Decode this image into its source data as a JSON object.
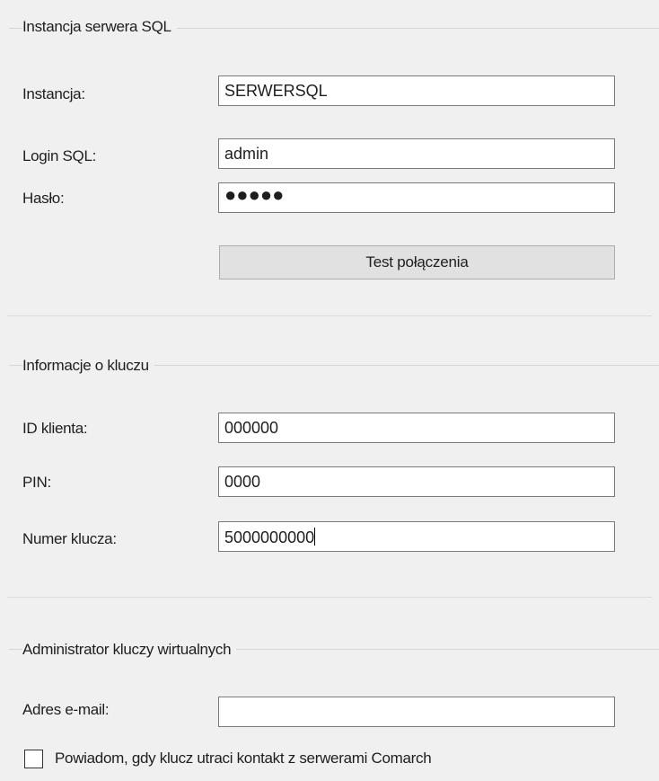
{
  "sql_group": {
    "title": "Instancja serwera SQL",
    "instance_label": "Instancja:",
    "instance_value": "SERWERSQL",
    "login_label": "Login SQL:",
    "login_value": "admin",
    "password_label": "Hasło:",
    "password_value": "●●●●●",
    "test_button": "Test połączenia"
  },
  "key_group": {
    "title": "Informacje o kluczu",
    "client_id_label": "ID klienta:",
    "client_id_value": "000000",
    "pin_label": "PIN:",
    "pin_value": "0000",
    "key_number_label": "Numer klucza:",
    "key_number_value": "5000000000"
  },
  "admin_group": {
    "title": "Administrator kluczy wirtualnych",
    "email_label": "Adres e-mail:",
    "email_value": "",
    "notify_label": "Powiadom, gdy klucz utraci kontakt z serwerami Comarch",
    "notify_checked": false
  }
}
